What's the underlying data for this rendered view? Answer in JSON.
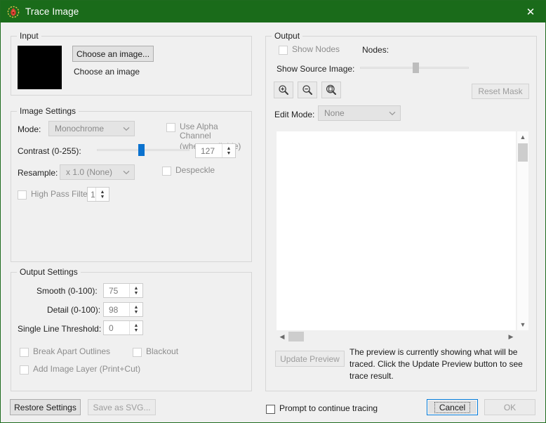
{
  "window": {
    "title": "Trace Image",
    "icon": "app-logo-icon",
    "close_label": "✕",
    "titlebar_color": "#1a6b1a"
  },
  "input": {
    "legend": "Input",
    "choose_button": "Choose an image...",
    "status_text": "Choose an image",
    "thumbnail_color": "#000000"
  },
  "image_settings": {
    "legend": "Image Settings",
    "mode_label": "Mode:",
    "mode_value": "Monochrome",
    "alpha_line1": "Use Alpha Channel",
    "alpha_line2": "(when available)",
    "contrast_label": "Contrast (0-255):",
    "contrast_value": "127",
    "contrast_percent": 50,
    "resample_label": "Resample:",
    "resample_value": "x 1.0 (None)",
    "despeckle_label": "Despeckle",
    "highpass_label": "High Pass Filter",
    "highpass_value": "1"
  },
  "output_settings": {
    "legend": "Output Settings",
    "smooth_label": "Smooth (0-100):",
    "smooth_value": "75",
    "detail_label": "Detail (0-100):",
    "detail_value": "98",
    "threshold_label": "Single Line Threshold:",
    "threshold_value": "0",
    "break_apart_label": "Break Apart Outlines",
    "blackout_label": "Blackout",
    "add_image_layer_label": "Add Image Layer (Print+Cut)"
  },
  "output": {
    "legend": "Output",
    "show_nodes_label": "Show Nodes",
    "nodes_label": "Nodes:",
    "nodes_value": "",
    "show_source_label": "Show Source Image:",
    "show_source_percent": 52,
    "zoom_in_icon": "zoom-in-icon",
    "zoom_out_icon": "zoom-out-icon",
    "zoom_fit_icon": "zoom-fit-icon",
    "reset_mask_label": "Reset Mask",
    "edit_mode_label": "Edit Mode:",
    "edit_mode_value": "None",
    "update_preview_label": "Update Preview",
    "help_line1": "The preview is currently showing what will be",
    "help_line2": "traced. Click the Update Preview button to see",
    "help_line3": "trace result."
  },
  "footer": {
    "restore_label": "Restore Settings",
    "save_svg_label": "Save as SVG...",
    "prompt_label": "Prompt to continue tracing",
    "cancel_label": "Cancel",
    "ok_label": "OK",
    "focus_color": "#0078d7"
  }
}
